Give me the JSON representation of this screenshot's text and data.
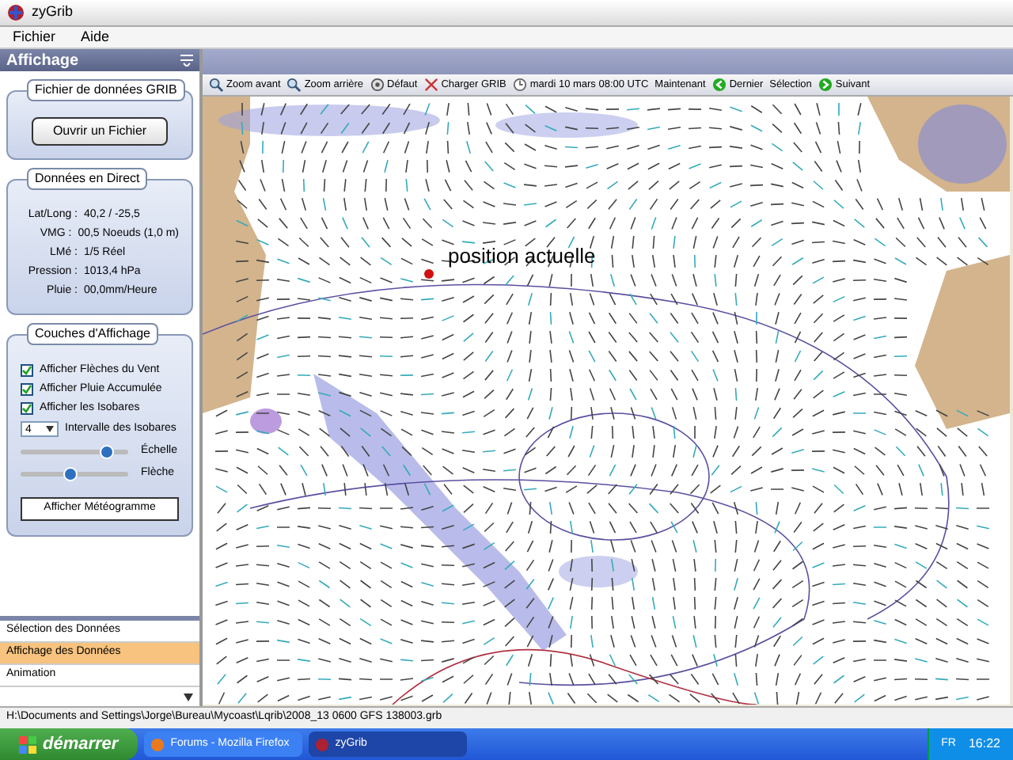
{
  "window": {
    "title": "zyGrib"
  },
  "menu": [
    "Fichier",
    "Aide"
  ],
  "sidebar": {
    "title": "Affichage",
    "file_group": {
      "title": "Fichier de données GRIB",
      "button": "Ouvrir un Fichier"
    },
    "live_group": {
      "title": "Données en Direct",
      "rows": [
        {
          "label": "Lat/Long :",
          "value": "40,2 / -25,5"
        },
        {
          "label": "VMG :",
          "value": "00,5 Noeuds (1,0 m)"
        },
        {
          "label": "LMé :",
          "value": "1/5 Réel"
        },
        {
          "label": "Pression :",
          "value": "1013,4 hPa"
        },
        {
          "label": "Pluie :",
          "value": "00,0mm/Heure"
        }
      ]
    },
    "layers_group": {
      "title": "Couches d'Affichage",
      "checks": [
        {
          "label": "Afficher Flèches du Vent",
          "checked": true
        },
        {
          "label": "Afficher Pluie Accumulée",
          "checked": true
        },
        {
          "label": "Afficher les Isobares",
          "checked": true
        }
      ],
      "interval": {
        "value": "4",
        "label": "Intervalle des Isobares"
      },
      "sliders": [
        {
          "label": "Échelle",
          "level": 0.8
        },
        {
          "label": "Flèche",
          "level": 0.45
        }
      ],
      "button": "Afficher Météogramme"
    },
    "panels": [
      {
        "label": "Sélection des Données",
        "selected": false
      },
      {
        "label": "Affichage des Données",
        "selected": true
      },
      {
        "label": "Animation",
        "selected": false
      }
    ]
  },
  "toolbar": [
    {
      "kind": "zoomin",
      "label": "Zoom avant"
    },
    {
      "kind": "zoomout",
      "label": "Zoom arrière"
    },
    {
      "kind": "reset",
      "label": "Défaut"
    },
    {
      "kind": "load",
      "label": "Charger GRIB"
    },
    {
      "kind": "date",
      "label": "mardi 10 mars 08:00 UTC"
    },
    {
      "kind": "plain",
      "label": "Maintenant"
    },
    {
      "kind": "prev",
      "label": "Dernier"
    },
    {
      "kind": "plain",
      "label": "Sélection"
    },
    {
      "kind": "next",
      "label": "Suivant"
    }
  ],
  "map": {
    "marker_label": "position actuelle"
  },
  "status_bar": "H:\\Documents and Settings\\Jorge\\Bureau\\Mycoast\\Lqrib\\2008_13 0600 GFS 138003.grb",
  "taskbar": {
    "start": "démarrer",
    "tasks": [
      {
        "label": "Forums - Mozilla Firefox",
        "selected": false
      },
      {
        "label": "zyGrib",
        "selected": true
      }
    ],
    "lang": "FR",
    "time": "16:22"
  }
}
